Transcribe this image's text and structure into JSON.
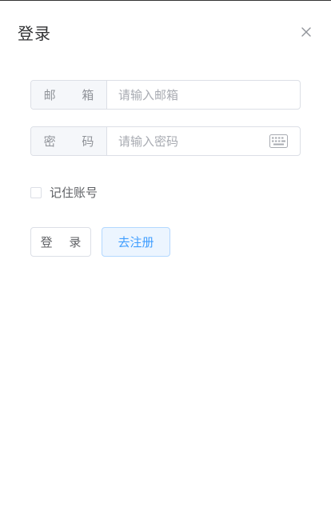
{
  "dialog": {
    "title": "登录"
  },
  "form": {
    "email": {
      "label": "邮 箱",
      "placeholder": "请输入邮箱",
      "value": ""
    },
    "password": {
      "label": "密 码",
      "placeholder": "请输入密码",
      "value": ""
    },
    "remember": {
      "label": "记住账号",
      "checked": false
    }
  },
  "actions": {
    "login_label": "登 录",
    "register_label": "去注册"
  },
  "icons": {
    "close": "close-icon",
    "keyboard": "keyboard-icon"
  },
  "colors": {
    "primary": "#409eff",
    "primary_light_bg": "#ecf5ff",
    "border": "#dcdfe6",
    "prefix_bg": "#f5f7fa",
    "text_muted": "#909399",
    "placeholder": "#a8abb2"
  }
}
